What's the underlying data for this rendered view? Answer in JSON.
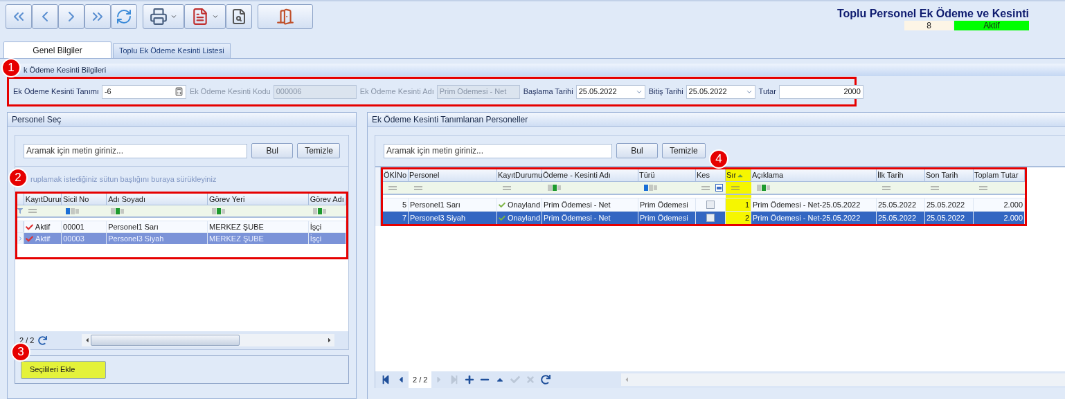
{
  "header": {
    "title": "Toplu Personel Ek Ödeme ve Kesinti",
    "record_no": "8",
    "status": {
      "label": "Aktif",
      "active": true
    }
  },
  "tabs": [
    {
      "label": "Genel Bilgiler",
      "selected": true
    },
    {
      "label": "Toplu Ek Ödeme Kesinti Listesi",
      "selected": false
    }
  ],
  "info_section": {
    "title": "k Ödeme Kesinti Bilgileri",
    "marker": "1",
    "fields": [
      {
        "label": "Ek Ödeme Kesinti Tanımı",
        "value": "-6",
        "kind": "lookup",
        "disabled": false
      },
      {
        "label": "Ek Ödeme Kesinti Kodu",
        "value": "000006",
        "kind": "text",
        "disabled": true
      },
      {
        "label": "Ek Ödeme Kesinti Adı",
        "value": "Prim Ödemesi - Net",
        "kind": "text",
        "disabled": true
      },
      {
        "label": "Başlama Tarihi",
        "value": "25.05.2022",
        "kind": "date",
        "disabled": false
      },
      {
        "label": "Bitiş Tarihi",
        "value": "25.05.2022",
        "kind": "date",
        "disabled": false
      },
      {
        "label": "Tutar",
        "value": "2000",
        "kind": "number",
        "disabled": false
      }
    ]
  },
  "left_panel": {
    "title": "Personel Seç",
    "search_placeholder": "Aramak için metin giriniz...",
    "search_buttons": [
      "Bul",
      "Temizle"
    ],
    "group_hint": "ruplamak istediğiniz sütun başlığını buraya sürükleyiniz",
    "grid_marker": "2",
    "columns": [
      {
        "label": "KayıtDurur",
        "kind": "equals"
      },
      {
        "label": "Sicil No",
        "kind": "text-blue"
      },
      {
        "label": "Adı Soyadı",
        "kind": "text-green"
      },
      {
        "label": "Görev Yeri",
        "kind": "text-green"
      },
      {
        "label": "Görev Adı",
        "kind": "text-green"
      }
    ],
    "rows": [
      {
        "cells": [
          "Aktif",
          "00001",
          "Personel1 Sarı",
          "MERKEZ ŞUBE",
          "İşçi"
        ],
        "selected": false
      },
      {
        "cells": [
          "Aktif",
          "00003",
          "Personel3 Siyah",
          "MERKEZ ŞUBE",
          "İşçi"
        ],
        "selected": true
      }
    ],
    "pager": "2 / 2",
    "button_marker": "3",
    "add_button": "Seçilileri Ekle"
  },
  "right_panel": {
    "title": "Ek Ödeme Kesinti Tanımlanan Personeller",
    "search_placeholder": "Aramak için metin giriniz...",
    "search_buttons": [
      "Bul",
      "Temizle"
    ],
    "grid_marker": "4",
    "columns": [
      {
        "label": "ÖKİNo",
        "kind": "equals"
      },
      {
        "label": "Personel",
        "kind": "equals"
      },
      {
        "label": "KayıtDurumu",
        "kind": "equals"
      },
      {
        "label": "Ödeme - Kesinti Adı",
        "kind": "text-green"
      },
      {
        "label": "Türü",
        "kind": "text-blue"
      },
      {
        "label": "Kes",
        "kind": "equals-check"
      },
      {
        "label": "Sır",
        "kind": "equals"
      },
      {
        "label": "Açıklama",
        "kind": "text-green"
      },
      {
        "label": "İlk Tarih",
        "kind": "equals"
      },
      {
        "label": "Son Tarih",
        "kind": "equals"
      },
      {
        "label": "Toplam Tutar",
        "kind": "equals"
      }
    ],
    "rows": [
      {
        "no": "5",
        "personel": "Personel1 Sarı",
        "kayit": "Onayland",
        "odeme": "Prim Ödemesi - Net",
        "turu": "Prim Ödemesi",
        "kesinti": false,
        "sira": "1",
        "aciklama": "Prim Ödemesi - Net-25.05.2022",
        "ilk": "25.05.2022",
        "son": "25.05.2022",
        "toplam": "2.000",
        "selected": false
      },
      {
        "no": "7",
        "personel": "Personel3 Siyah",
        "kayit": "Onayland",
        "odeme": "Prim Ödemesi - Net",
        "turu": "Prim Ödemesi",
        "kesinti": false,
        "sira": "2",
        "aciklama": "Prim Ödemesi - Net-25.05.2022",
        "ilk": "25.05.2022",
        "son": "25.05.2022",
        "toplam": "2.000",
        "selected": true
      }
    ],
    "pager": "2 / 2",
    "nav": [
      {
        "kind": "first",
        "disabled": false
      },
      {
        "kind": "prev",
        "disabled": false
      },
      {
        "kind": "pager"
      },
      {
        "kind": "next",
        "disabled": true
      },
      {
        "kind": "last",
        "disabled": true
      },
      {
        "kind": "add",
        "disabled": false
      },
      {
        "kind": "remove",
        "disabled": false
      },
      {
        "kind": "up",
        "disabled": false
      },
      {
        "kind": "save",
        "disabled": true
      },
      {
        "kind": "cancel",
        "disabled": true
      },
      {
        "kind": "refresh",
        "disabled": false
      }
    ]
  }
}
